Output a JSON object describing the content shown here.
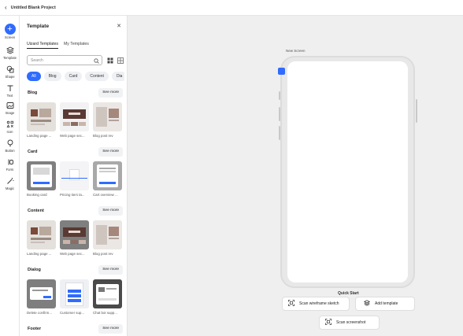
{
  "header": {
    "back_icon": "back-arrow-icon",
    "title": "Untitled Blank Project"
  },
  "rail": {
    "items": [
      {
        "label": "Screen",
        "icon": "plus-icon"
      },
      {
        "label": "Template",
        "icon": "layers-icon"
      },
      {
        "label": "Shape",
        "icon": "shapes-icon"
      },
      {
        "label": "Text",
        "icon": "text-icon"
      },
      {
        "label": "Image",
        "icon": "image-icon"
      },
      {
        "label": "Icon",
        "icon": "icon-grid-icon"
      },
      {
        "label": "Button",
        "icon": "button-icon"
      },
      {
        "label": "Form",
        "icon": "form-icon"
      },
      {
        "label": "Magic",
        "icon": "magic-wand-icon"
      }
    ]
  },
  "panel": {
    "title": "Template",
    "close_icon": "close-icon",
    "tabs": [
      {
        "label": "Uizard Templates",
        "active": true
      },
      {
        "label": "My Templates",
        "active": false
      }
    ],
    "search": {
      "placeholder": "Search",
      "value": ""
    },
    "chips": [
      {
        "label": "All",
        "active": true
      },
      {
        "label": "Blog",
        "active": false
      },
      {
        "label": "Card",
        "active": false
      },
      {
        "label": "Content",
        "active": false
      },
      {
        "label": "Dia",
        "active": false
      }
    ],
    "see_more_label": "See more",
    "sections": [
      {
        "title": "Blog",
        "cards": [
          "Landing page ...",
          "Web page sec...",
          "Blog post rev"
        ]
      },
      {
        "title": "Card",
        "cards": [
          "Booking card",
          "Pricing tiers ta...",
          "Cart overview ..."
        ]
      },
      {
        "title": "Content",
        "cards": [
          "Landing page ...",
          "Web page sec...",
          "Blog post rev"
        ]
      },
      {
        "title": "Dialog",
        "cards": [
          "Delete confirm...",
          "Customer sup...",
          "Chat bot supp..."
        ]
      },
      {
        "title": "Footer",
        "cards": []
      }
    ]
  },
  "canvas": {
    "screen_label": "New Screen",
    "quick_start": {
      "title": "Quick Start",
      "buttons": [
        {
          "label": "Scan wireframe sketch",
          "icon": "scan-icon"
        },
        {
          "label": "Add template",
          "icon": "layers-icon"
        },
        {
          "label": "Scan screenshot",
          "icon": "scan-icon"
        }
      ]
    }
  },
  "colors": {
    "accent": "#2f6bff",
    "panel_bg": "#ffffff",
    "canvas_bg": "#efefef"
  }
}
